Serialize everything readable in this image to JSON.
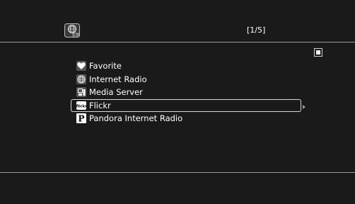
{
  "header": {
    "source_icon": "usb-globe-icon",
    "page_indicator": "[1/5]"
  },
  "menu": {
    "items": [
      {
        "label": "Favorite",
        "icon": "heart-icon",
        "selected": false
      },
      {
        "label": "Internet Radio",
        "icon": "globe-icon",
        "selected": false
      },
      {
        "label": "Media Server",
        "icon": "media-server-icon",
        "selected": false
      },
      {
        "label": "Flickr",
        "icon": "flickr-icon",
        "selected": true
      },
      {
        "label": "Pandora Internet Radio",
        "icon": "pandora-icon",
        "selected": false
      }
    ]
  },
  "colors": {
    "background": "#1a1a1a",
    "text": "#ffffff",
    "rule": "#9a9a9a",
    "highlight_border": "#d8d8d8"
  }
}
